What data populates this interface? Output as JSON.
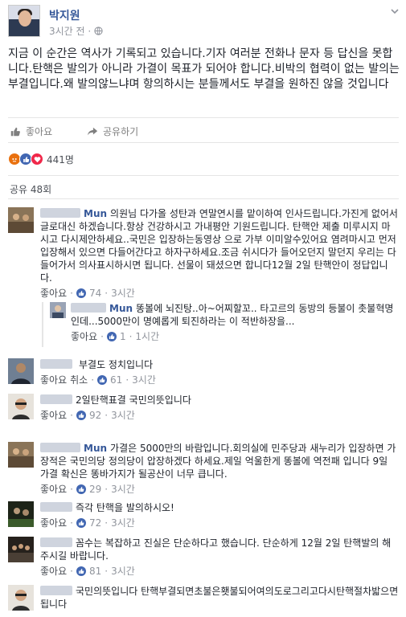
{
  "post": {
    "author": "박지원",
    "time": "3시간 전",
    "audience_sep": "·",
    "body": "지금 이 순간은 역사가 기록되고 있습니다.기자 여러분 전화나 문자 등 답신을 못합니다.탄핵은 발의가 아니라 가결이 목표가 되어야 합니다.비박의 협력이 없는 발의는 부결입니다.왜 발의않느냐며 항의하시는 분들께서도 부결을 원하진 않을 것입니다"
  },
  "actions": {
    "like": "좋아요",
    "share": "공유하기"
  },
  "reactions": {
    "count": "441명"
  },
  "shares": {
    "label": "공유 48회"
  },
  "comments": [
    {
      "name": "Mun",
      "text": "의원님 다가올 성탄과 연말연시를 맡이하여 인사드립니다.가진게 없어서 글로대신 하겠습니다.항상 건강하시고 가내평안 기원드립니다. 탄핵안 제출 미루시지 마시고 다시제안하세요..국민은 입장하는동영상 으로 가부 이미알수있어요 염려마시고 먼저 입장해서 있으면 다들어간다고 하자구하세요.조금 쉬시다가 들어오던지 말던지 우리는 다들어가서 의사표시하시면 됩니다. 선물이 돼셨으면 합니다12월 2일 탄핵안이 정답입니다.",
      "meta": {
        "like": "좋아요",
        "dot": "·",
        "count": "74",
        "time": "3시간"
      },
      "reply": {
        "name": "Mun",
        "text": "똥볼에 뇌진탕..아~어찌할꼬.. 타고르의 동방의 등불이 촛불혁명인데...5000만이 명예롭게 퇴진하라는 이 적반하장을...",
        "meta": {
          "like": "좋아요",
          "dot": "·",
          "count": "1",
          "time": "1시간"
        }
      }
    },
    {
      "name": "",
      "text": "부결도 정치입니다",
      "meta": {
        "like": "좋아요",
        "cancel": "취소",
        "dot": "·",
        "count": "61",
        "time": "3시간"
      }
    },
    {
      "name": "",
      "text": "2일탄핵표결 국민의뜻입니다",
      "meta": {
        "like": "좋아요",
        "dot": "·",
        "count": "92",
        "time": "3시간"
      }
    },
    {
      "name": "Mun",
      "text": "가결은 5000만의 바람입니다.회의실에 민주당과 새누리가 입장하면 가장적은 국민의당 정의당이 압장하겠다 하세요.제일 억울한게 똥볼에 역전패 입니다 9일 가결 확신은 똥바가지가 될공산이 너무 큽니다.",
      "meta": {
        "like": "좋아요",
        "dot": "·",
        "count": "29",
        "time": "3시간"
      }
    },
    {
      "name": "",
      "text": "즉각 탄핵을 발의하시오!",
      "meta": {
        "like": "좋아요",
        "dot": "·",
        "count": "72",
        "time": "3시간"
      }
    },
    {
      "name": "",
      "text": "꼼수는 복잡하고 진실은 단순하다고 했습니다. 단순하게 12월 2일 탄핵발의 해주시길 바랍니다.",
      "meta": {
        "like": "좋아요",
        "dot": "·",
        "count": "81",
        "time": "3시간"
      }
    },
    {
      "name": "",
      "text": "국민의뜻입니다 탄핵부결되면초불은횃불되어여의도로그리고다시탄핵절차밟으면됩니다"
    }
  ],
  "colors": {
    "link": "#365899",
    "meta": "#90949c",
    "like_blue": "#4267b2"
  },
  "icons": [
    "thumbs-up-icon",
    "share-icon",
    "angry-reaction-icon",
    "like-reaction-icon",
    "love-reaction-icon",
    "chevron-down-icon"
  ]
}
